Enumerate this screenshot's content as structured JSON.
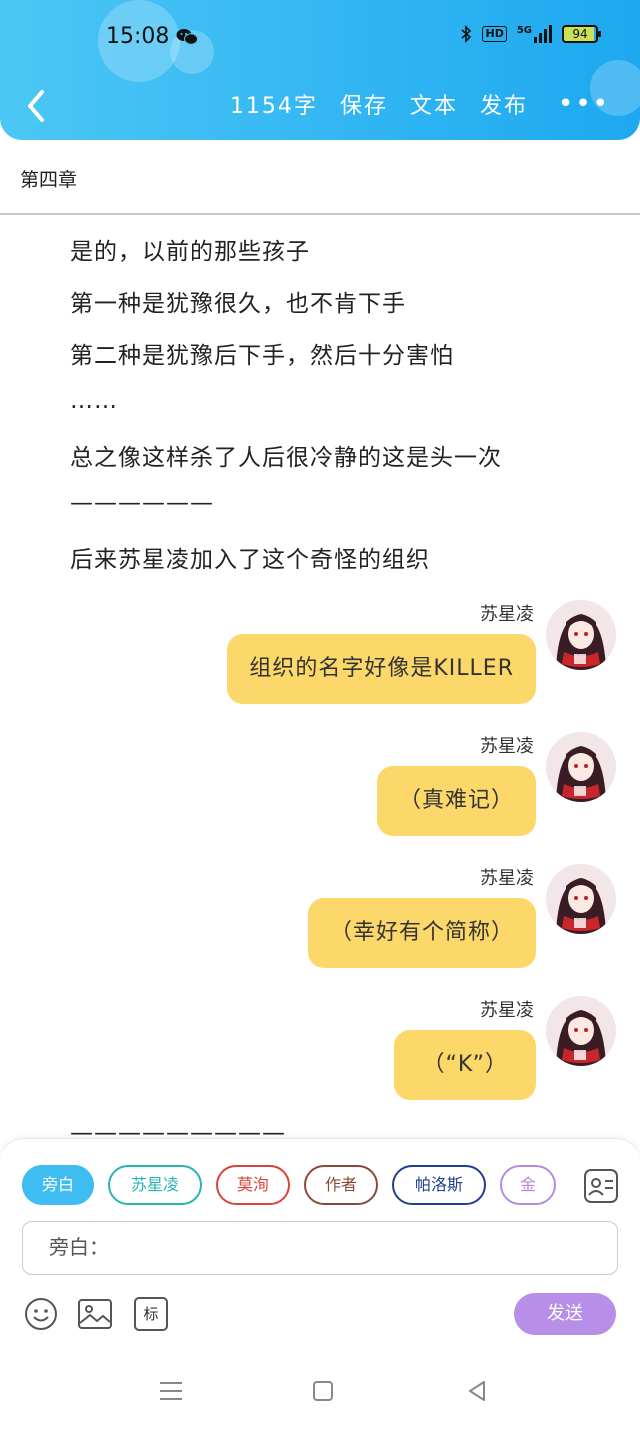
{
  "status_bar": {
    "time": "15:08",
    "network": "5G",
    "hd": "HD",
    "battery": "94"
  },
  "header": {
    "word_count": "1154字",
    "save": "保存",
    "text": "文本",
    "publish": "发布",
    "more": "•••"
  },
  "chapter_title": "第四章",
  "narration": [
    "是的，以前的那些孩子",
    "第一种是犹豫很久，也不肯下手",
    "第二种是犹豫后下手，然后十分害怕",
    "……",
    "总之像这样杀了人后很冷静的这是头一次",
    "——————",
    "后来苏星凌加入了这个奇怪的组织"
  ],
  "messages": [
    {
      "speaker": "苏星凌",
      "text": "组织的名字好像是KILLER"
    },
    {
      "speaker": "苏星凌",
      "text": "（真难记）"
    },
    {
      "speaker": "苏星凌",
      "text": "（幸好有个简称）"
    },
    {
      "speaker": "苏星凌",
      "text": "（“K”）"
    }
  ],
  "trailing_dashes": "—————————",
  "characters": [
    {
      "label": "旁白",
      "color": "#3fbdf0",
      "filled": true
    },
    {
      "label": "苏星凌",
      "color": "#27b5b0",
      "filled": false
    },
    {
      "label": "莫洵",
      "color": "#d9443a",
      "filled": false
    },
    {
      "label": "作者",
      "color": "#8a4a3a",
      "filled": false
    },
    {
      "label": "帕洛斯",
      "color": "#1f3f8f",
      "filled": false
    },
    {
      "label": "金",
      "color": "#b58be0",
      "filled": false
    }
  ],
  "input": {
    "prefix": "旁白："
  },
  "tools": {
    "tag_label": "标"
  },
  "send_label": "发送",
  "colors": {
    "header_start": "#4cc7f5",
    "header_end": "#1da8f0",
    "bubble": "#fcd86a",
    "send": "#b78ee8"
  }
}
